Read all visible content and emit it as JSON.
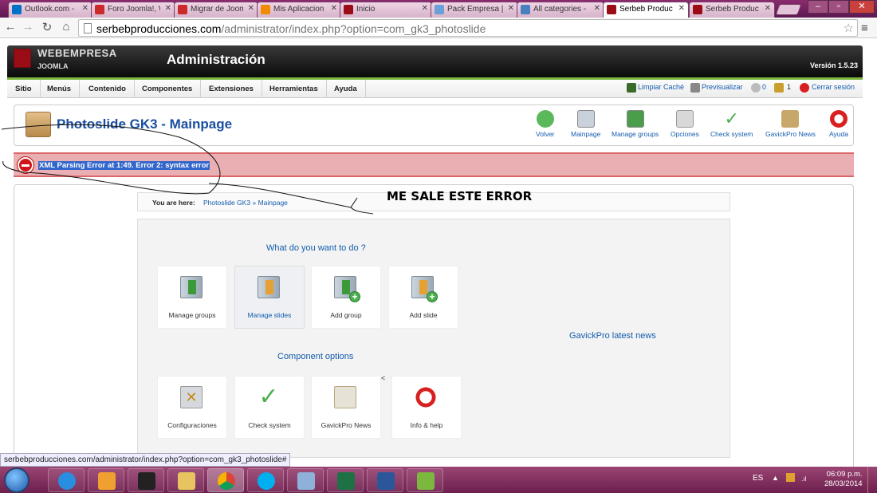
{
  "browser": {
    "tabs": [
      {
        "label": "Outlook.com -",
        "icon": "outlook-icon",
        "color": "#0072c6"
      },
      {
        "label": "Foro Joomla!, W",
        "icon": "webempresa-icon",
        "color": "#cc2a2a"
      },
      {
        "label": "Migrar de Joom",
        "icon": "webempresa-icon",
        "color": "#cc2a2a"
      },
      {
        "label": "Mis Aplicacion",
        "icon": "op-icon",
        "color": "#f08a00"
      },
      {
        "label": "Inicio",
        "icon": "joomla-icon",
        "color": "#9a0d16"
      },
      {
        "label": "Pack Empresa |",
        "icon": "pack-icon",
        "color": "#6aa0d8"
      },
      {
        "label": "All categories -",
        "icon": "people-icon",
        "color": "#4a7fc0"
      },
      {
        "label": "Serbeb Produc",
        "icon": "joomla-icon",
        "color": "#9a0d16",
        "active": true
      },
      {
        "label": "Serbeb Produc",
        "icon": "joomla-icon",
        "color": "#9a0d16"
      }
    ],
    "url_host": "serbebproducciones.com",
    "url_path": "/administrator/index.php?option=com_gk3_photoslide",
    "status_url": "serbebproducciones.com/administrator/index.php?option=com_gk3_photoslide#"
  },
  "joomla": {
    "brand_top": "WEBEMPRESA",
    "brand_bottom": "JOOMLA",
    "admin_title": "Administración",
    "version": "Versión 1.5.23",
    "menu": [
      "Sitio",
      "Menús",
      "Contenido",
      "Componentes",
      "Extensiones",
      "Herramientas",
      "Ayuda"
    ],
    "right_menu": {
      "clear_cache": "Limpiar Caché",
      "preview": "Previsualizar",
      "messages": "0",
      "users": "1",
      "logout": "Cerrar sesión"
    }
  },
  "component": {
    "title": "Photoslide GK3 - Mainpage",
    "toolbar": [
      {
        "label": "Volver",
        "icon": "back-icon",
        "color": "#5bb85b"
      },
      {
        "label": "Mainpage",
        "icon": "home-icon",
        "color": "#c9d2db"
      },
      {
        "label": "Manage groups",
        "icon": "groups-icon",
        "color": "#4a9d4a"
      },
      {
        "label": "Opciones",
        "icon": "tools-icon",
        "color": "#d8d8d8"
      },
      {
        "label": "Check system",
        "icon": "check-icon",
        "color": "#4caf50"
      },
      {
        "label": "GavickPro News",
        "icon": "news-icon",
        "color": "#c8a86a"
      },
      {
        "label": "Ayuda",
        "icon": "help-icon",
        "color": "#d82020"
      }
    ]
  },
  "error": {
    "message": "XML Parsing Error at 1:49. Error 2: syntax error"
  },
  "annotation": "ME SALE ESTE ERROR",
  "breadcrumb": {
    "label": "You are here:",
    "item1": "Photoslide GK3",
    "sep": "»",
    "item2": "Mainpage"
  },
  "main": {
    "question": "What do you want to do ?",
    "actions": [
      {
        "label": "Manage groups",
        "icon": "manage-groups-icon"
      },
      {
        "label": "Manage slides",
        "icon": "manage-slides-icon"
      },
      {
        "label": "Add group",
        "icon": "add-group-icon"
      },
      {
        "label": "Add slide",
        "icon": "add-slide-icon"
      }
    ],
    "news_title": "GavickPro latest news",
    "options_title": "Component options",
    "options": [
      {
        "label": "Configuraciones",
        "icon": "settings-icon"
      },
      {
        "label": "Check system",
        "icon": "check-icon"
      },
      {
        "label": "GavickPro News",
        "icon": "news-icon"
      },
      {
        "label": "Info & help",
        "icon": "lifebuoy-icon"
      }
    ],
    "stray_char": "<"
  },
  "taskbar": {
    "apps": [
      "ie-icon",
      "media-icon",
      "game-icon",
      "explorer-icon",
      "chrome-icon",
      "skype-icon",
      "notepad-icon",
      "excel-icon",
      "word-icon",
      "app-icon"
    ],
    "lang": "ES",
    "time": "06:09 p.m.",
    "date": "28/03/2014"
  }
}
